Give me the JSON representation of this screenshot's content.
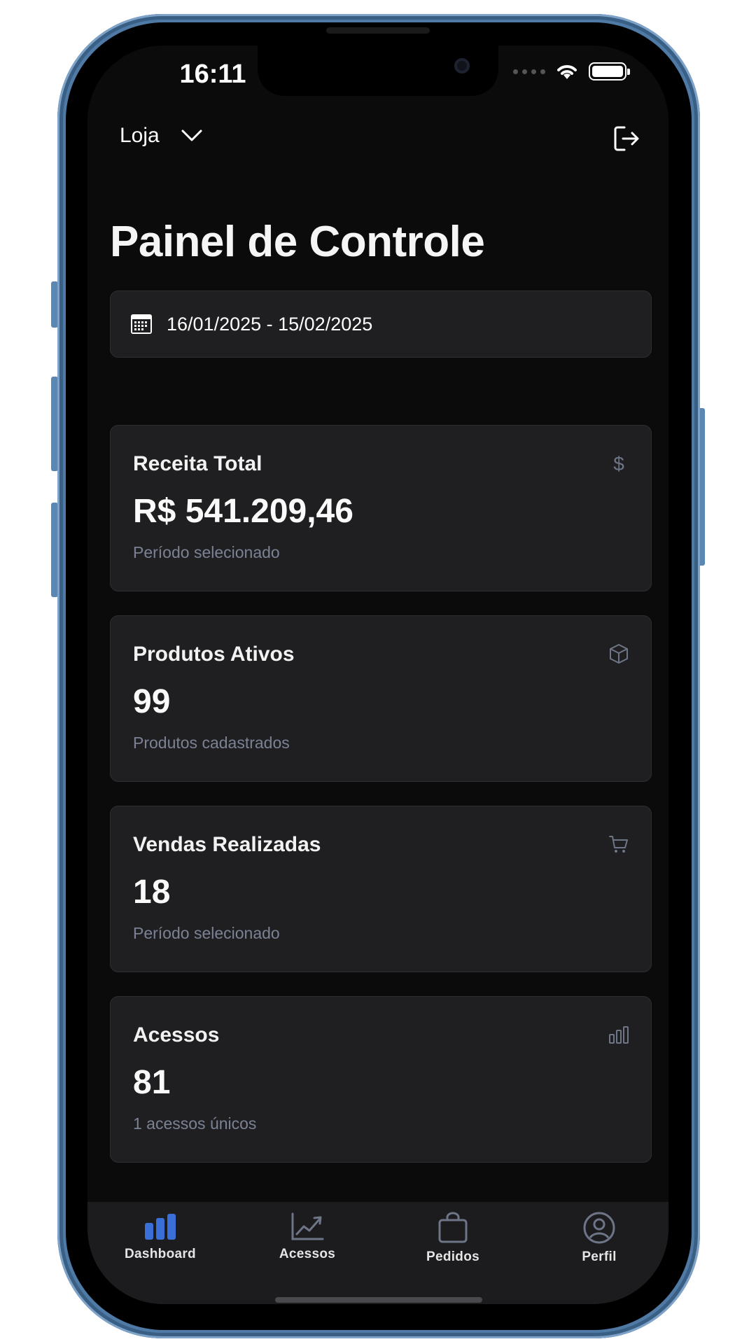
{
  "status_bar": {
    "time": "16:11"
  },
  "header": {
    "store_label": "Loja"
  },
  "page": {
    "title": "Painel de Controle"
  },
  "date_range": {
    "value": "16/01/2025 - 15/02/2025"
  },
  "cards": [
    {
      "title": "Receita Total",
      "value": "R$ 541.209,46",
      "subtitle": "Período selecionado",
      "icon": "dollar-icon"
    },
    {
      "title": "Produtos Ativos",
      "value": "99",
      "subtitle": "Produtos cadastrados",
      "icon": "package-icon"
    },
    {
      "title": "Vendas Realizadas",
      "value": "18",
      "subtitle": "Período selecionado",
      "icon": "cart-icon"
    },
    {
      "title": "Acessos",
      "value": "81",
      "subtitle": "1 acessos únicos",
      "icon": "bars-icon"
    }
  ],
  "tabs": [
    {
      "label": "Dashboard",
      "icon": "bar-chart-icon",
      "active": true
    },
    {
      "label": "Acessos",
      "icon": "line-chart-icon",
      "active": false
    },
    {
      "label": "Pedidos",
      "icon": "shopping-bag-icon",
      "active": false
    },
    {
      "label": "Perfil",
      "icon": "user-circle-icon",
      "active": false
    }
  ],
  "colors": {
    "background": "#0b0b0c",
    "card": "#1f1f22",
    "active_tab": "#3b6fd8",
    "muted_text": "#7a8294"
  }
}
